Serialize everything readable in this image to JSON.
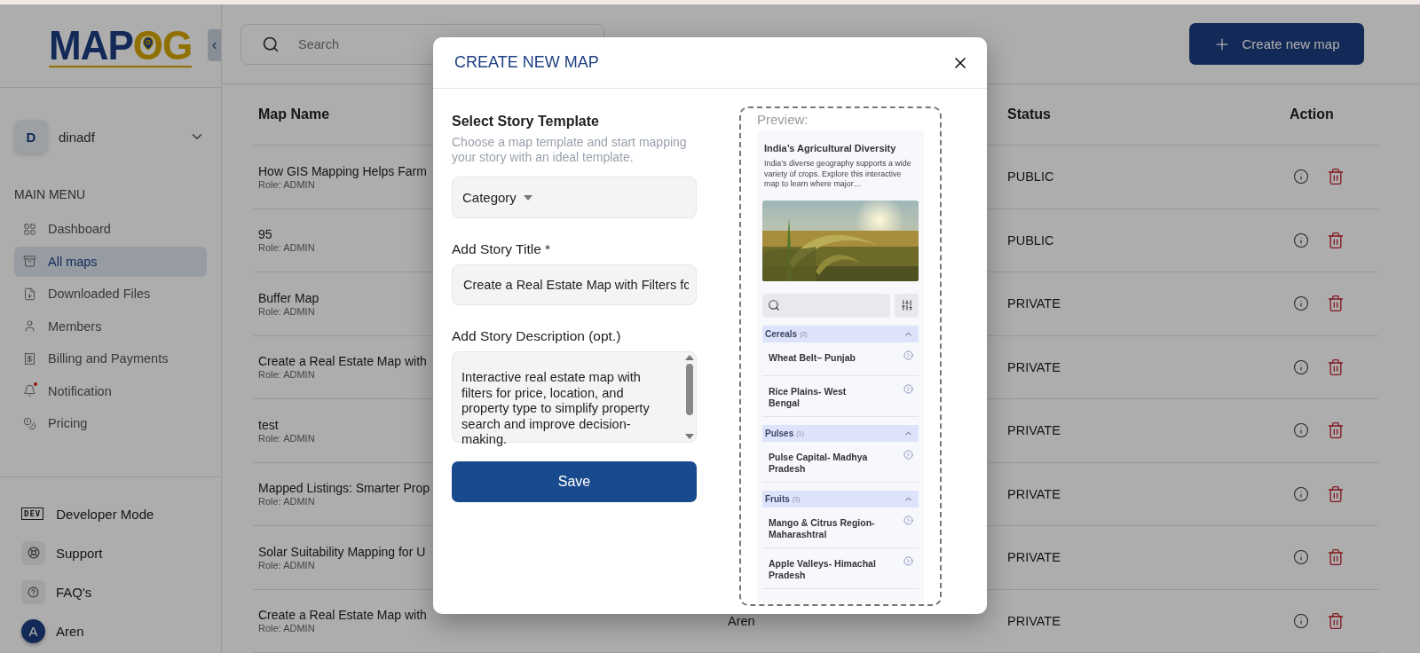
{
  "logo": {
    "primary": "MAP",
    "accent_1": "O",
    "accent_2": "G"
  },
  "search": {
    "placeholder": "Search"
  },
  "create_button": {
    "label": "Create new map"
  },
  "account": {
    "initial": "D",
    "name": "dinadf"
  },
  "main_menu": {
    "heading": "MAIN MENU",
    "items": [
      {
        "kind": "dashboard",
        "label": "Dashboard",
        "selected": false,
        "unread": false
      },
      {
        "kind": "maps",
        "label": "All maps",
        "selected": true,
        "unread": false
      },
      {
        "kind": "downloads",
        "label": "Downloaded Files",
        "selected": false,
        "unread": false
      },
      {
        "kind": "members",
        "label": "Members",
        "selected": false,
        "unread": false
      },
      {
        "kind": "billing",
        "label": "Billing and Payments",
        "selected": false,
        "unread": false
      },
      {
        "kind": "notification",
        "label": "Notification",
        "selected": false,
        "unread": true
      },
      {
        "kind": "pricing",
        "label": "Pricing",
        "selected": false,
        "unread": false
      }
    ]
  },
  "bottom_menu": [
    {
      "kind": "dev",
      "badge": "DEV",
      "label": "Developer Mode"
    },
    {
      "kind": "support",
      "label": "Support"
    },
    {
      "kind": "faq",
      "label": "FAQ's"
    },
    {
      "kind": "avatar",
      "initial": "A",
      "label": "Aren"
    }
  ],
  "table": {
    "columns": [
      "Map Name",
      "Status",
      "Action"
    ],
    "rows": [
      {
        "name": "How GIS Mapping Helps Farm",
        "role": "Role: ADMIN",
        "status": "PUBLIC"
      },
      {
        "name": "95",
        "role": "Role: ADMIN",
        "status": "PUBLIC"
      },
      {
        "name": "Buffer Map",
        "role": "Role: ADMIN",
        "status": "PRIVATE"
      },
      {
        "name": "Create a Real Estate Map with",
        "role": "Role: ADMIN",
        "status": "PRIVATE"
      },
      {
        "name": "test",
        "role": "Role: ADMIN",
        "status": "PRIVATE"
      },
      {
        "name": "Mapped Listings: Smarter Prop",
        "role": "Role: ADMIN",
        "status": "PRIVATE"
      },
      {
        "name": "Solar Suitability Mapping for U",
        "role": "Role: ADMIN",
        "status": "PRIVATE"
      },
      {
        "name": "Create a Real Estate Map with",
        "role": "Role: ADMIN",
        "owner": "Aren",
        "status": "PRIVATE"
      }
    ]
  },
  "modal": {
    "title": "CREATE NEW MAP",
    "template": {
      "heading": "Select Story Template",
      "hint": "Choose a map template and start mapping your story with an ideal template.",
      "select": "Category"
    },
    "story_title": {
      "label": "Add Story Title *",
      "value": "Create a Real Estate Map with Filters fc"
    },
    "description": {
      "label": "Add Story Description (opt.)",
      "value": "Interactive real estate map with filters for price, location, and property type to simplify property search and improve decision-making."
    },
    "save": "Save",
    "preview": {
      "label": "Preview:",
      "title": "India’s Agricultural Diversity",
      "text": "India’s diverse geography supports a wide variety of crops. Explore this interactive map to learn where major…",
      "sections": [
        {
          "name": "Cereals",
          "count": "(2)",
          "expanded": true,
          "items": [
            "Wheat Belt– Punjab",
            "Rice Plains- West Bengal"
          ]
        },
        {
          "name": "Pulses",
          "count": "(1)",
          "expanded": true,
          "items": [
            "Pulse Capital- Madhya Pradesh"
          ]
        },
        {
          "name": "Fruits",
          "count": "(3)",
          "expanded": true,
          "items": [
            "Mango & Citrus Region- Maharashtral",
            "Apple Valleys- Himachal Pradesh"
          ]
        }
      ]
    }
  }
}
